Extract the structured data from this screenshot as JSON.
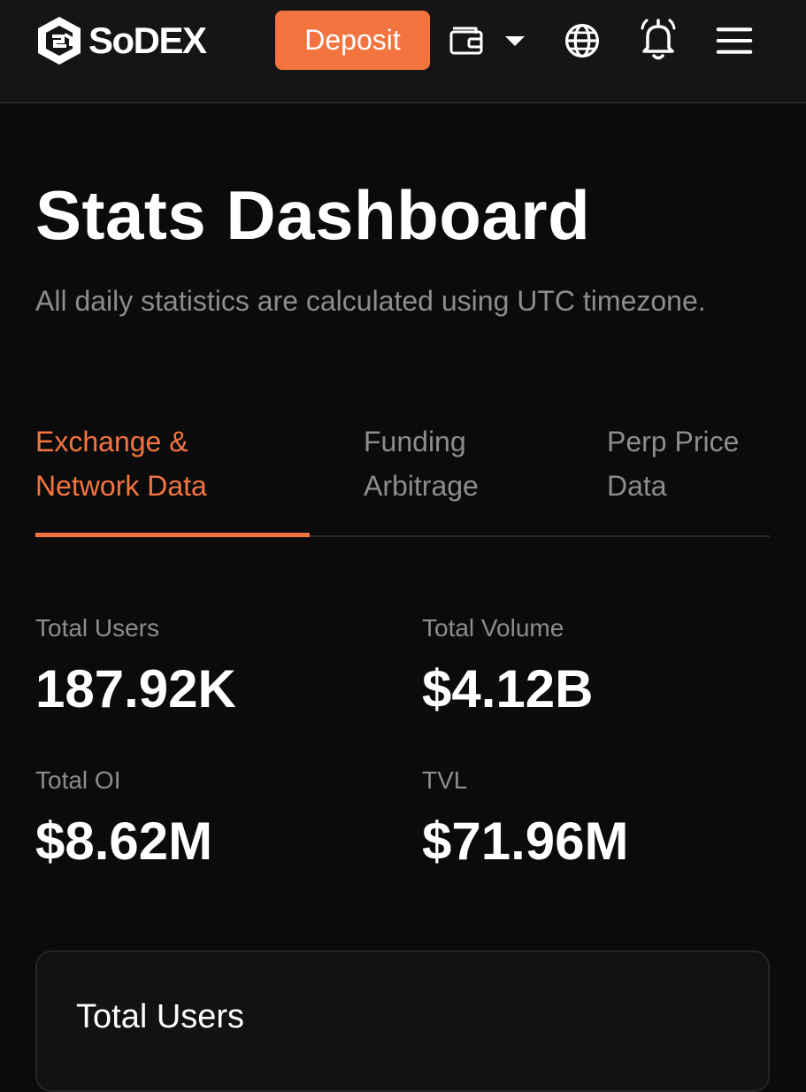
{
  "header": {
    "brand": "SoDEX",
    "deposit_label": "Deposit",
    "icons": [
      "logo-icon",
      "wallet-icon",
      "chevron-down-icon",
      "globe-icon",
      "bell-icon",
      "menu-icon"
    ]
  },
  "page": {
    "title": "Stats Dashboard",
    "subtitle": "All daily statistics are calculated using UTC timezone."
  },
  "tabs": [
    {
      "label": "Exchange &\nNetwork Data",
      "active": true
    },
    {
      "label": "Funding\nArbitrage",
      "active": false
    },
    {
      "label": "Perp Price\nData",
      "active": false
    }
  ],
  "stats": [
    {
      "label": "Total Users",
      "value": "187.92K"
    },
    {
      "label": "Total Volume",
      "value": "$4.12B"
    },
    {
      "label": "Total OI",
      "value": "$8.62M"
    },
    {
      "label": "TVL",
      "value": "$71.96M"
    }
  ],
  "chart_card": {
    "title": "Total Users"
  },
  "colors": {
    "accent": "#f47440",
    "background": "#0b0b0b",
    "header": "#151515",
    "muted_text": "#8d8d8d"
  }
}
